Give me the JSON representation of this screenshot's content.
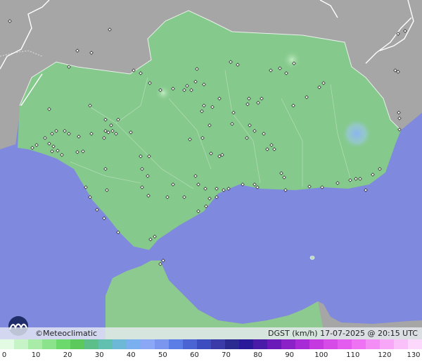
{
  "brand": "©Meteoclimatic",
  "product": "DGST (km/h)   17-07-2025 @ 20:15 UTC",
  "legend": {
    "ticks": [
      "0",
      "10",
      "20",
      "30",
      "40",
      "50",
      "60",
      "70",
      "80",
      "90",
      "100",
      "110",
      "120",
      "130"
    ],
    "colors": [
      "#e2fbe2",
      "#c6f4c6",
      "#a8eca8",
      "#8be48b",
      "#6cd96c",
      "#5cc95c",
      "#5cbf8a",
      "#62c0b0",
      "#6cb8d6",
      "#7ab0ef",
      "#8aa8f5",
      "#7a96ee",
      "#5a7ee6",
      "#4a64d4",
      "#3c4dc0",
      "#3a3aa8",
      "#2a2a90",
      "#2a1a9a",
      "#4a1aa8",
      "#6a1ab8",
      "#8a22c8",
      "#a82ad6",
      "#c43ae0",
      "#d64ae8",
      "#e45cef",
      "#ee72f3",
      "#f48cf6",
      "#f8a6f8",
      "#fac0fa",
      "#fcd8fc"
    ]
  },
  "map": {
    "colors": {
      "sea": "#7f89dd",
      "land_outside": "#a6a6a6",
      "region": "#85c98c",
      "borders": "#ffffff",
      "gust_hotspot": "#8fb8ee"
    }
  }
}
